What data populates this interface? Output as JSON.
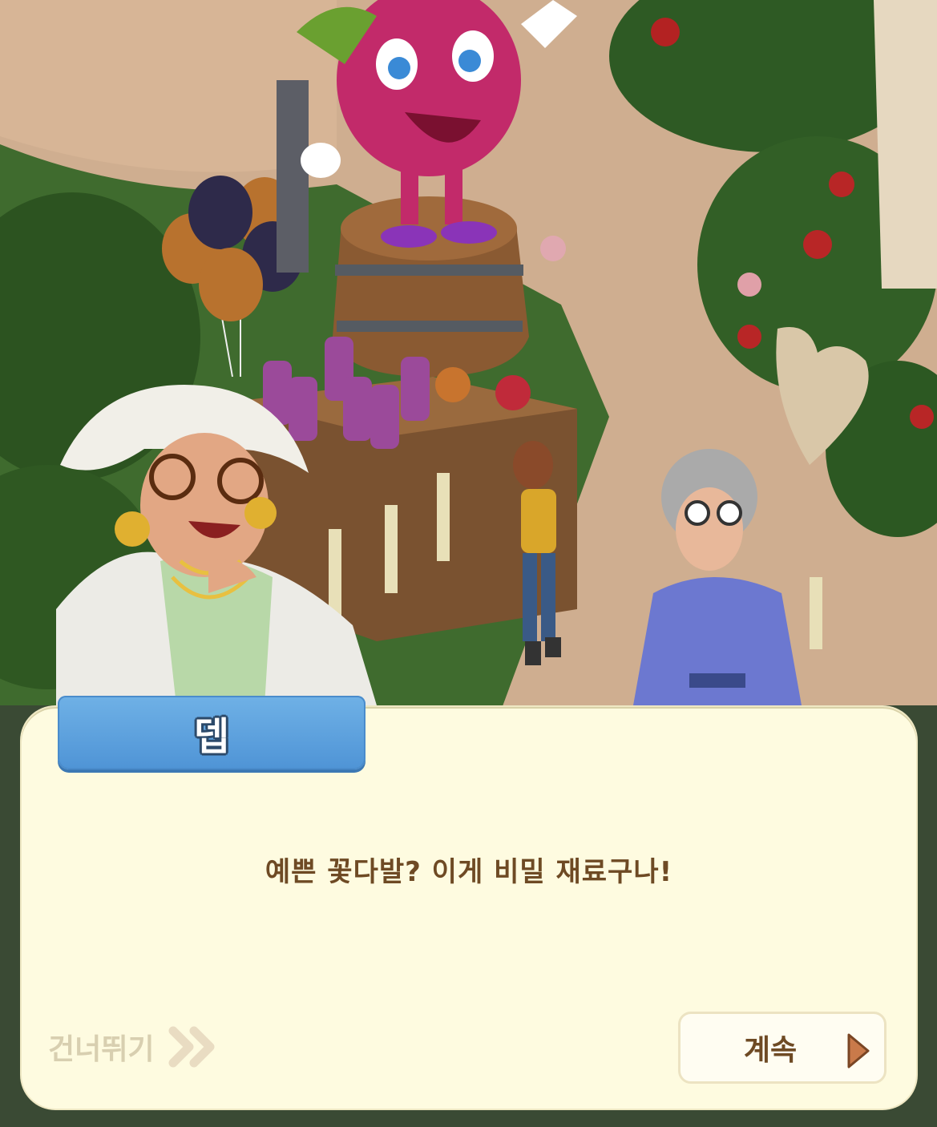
{
  "dialog": {
    "speaker": "뎁",
    "message": "예쁜 꽃다발? 이게 비밀 재료구나!",
    "skip_label": "건너뛰기",
    "continue_label": "계속"
  },
  "icons": {
    "skip": "double-chevron-right-icon",
    "continue": "play-triangle-icon"
  },
  "colors": {
    "name_tab": "#5aa1dd",
    "dialog_bg": "#fefbe0",
    "text": "#6e4a24",
    "skip_text": "#d8cfb0",
    "continue_arrow": "#c97a4a"
  }
}
